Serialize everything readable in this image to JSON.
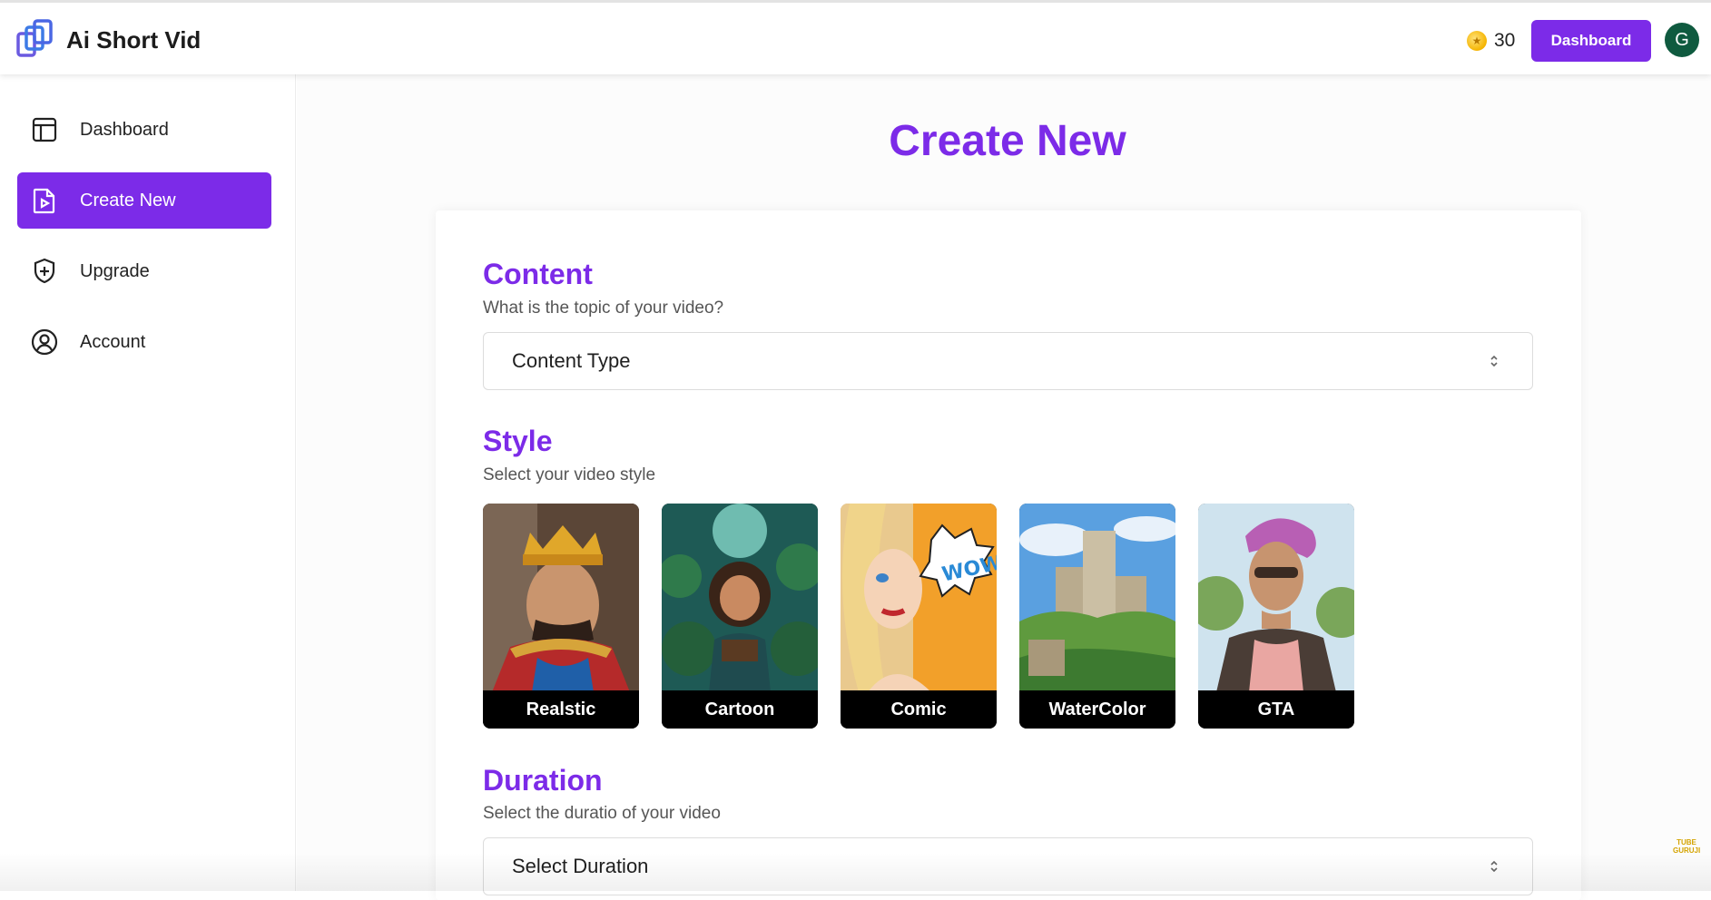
{
  "header": {
    "app_title": "Ai Short Vid",
    "logo_icon": "stacked-squares-logo",
    "coins": "30",
    "coin_icon": "gold-coin-icon",
    "dashboard_button": "Dashboard",
    "avatar_letter": "G"
  },
  "sidebar": {
    "items": [
      {
        "label": "Dashboard",
        "icon": "layout-panel-icon",
        "active": false
      },
      {
        "label": "Create New",
        "icon": "file-video-icon",
        "active": true
      },
      {
        "label": "Upgrade",
        "icon": "shield-plus-icon",
        "active": false
      },
      {
        "label": "Account",
        "icon": "user-circle-icon",
        "active": false
      }
    ]
  },
  "main": {
    "title": "Create New",
    "content": {
      "title": "Content",
      "subtitle": "What is the topic of your video?",
      "select_value": "Content Type"
    },
    "style": {
      "title": "Style",
      "subtitle": "Select your video style",
      "options": [
        "Realstic",
        "Cartoon",
        "Comic",
        "WaterColor",
        "GTA"
      ]
    },
    "duration": {
      "title": "Duration",
      "subtitle": "Select the duratio of your video",
      "select_value": "Select Duration"
    }
  },
  "watermark": {
    "text": "TUBE GURUJI"
  },
  "colors": {
    "accent": "#7c2be8",
    "avatar": "#0f5a3f"
  }
}
